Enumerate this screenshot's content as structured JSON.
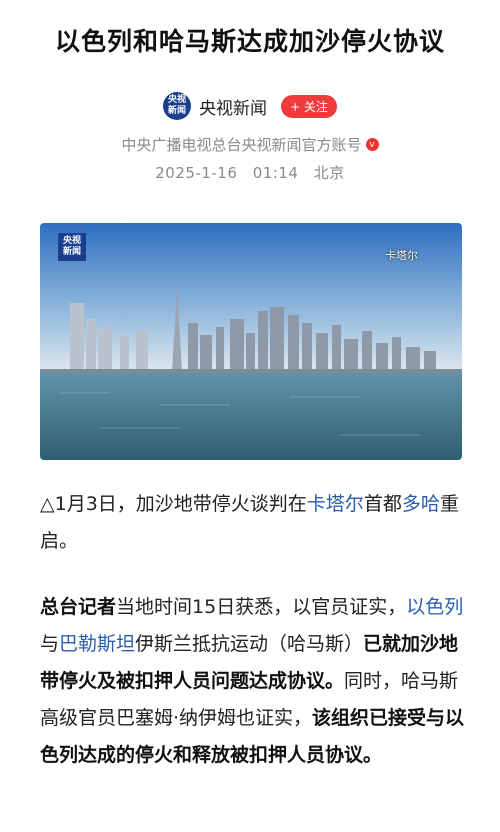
{
  "article": {
    "title": "以色列和哈马斯达成加沙停火协议",
    "source": {
      "logo_line1": "央视",
      "logo_line2": "新闻",
      "name": "央视新闻",
      "follow_label": "+ 关注",
      "account": "中央广播电视总台央视新闻官方账号",
      "verified_icon": "v"
    },
    "date": "2025-1-16",
    "time": "01:14",
    "location": "北京"
  },
  "hero_image": {
    "watermark_line1": "央视",
    "watermark_line2": "新闻",
    "caption_location": "卡塔尔"
  },
  "paragraph1": {
    "p1a": "△1月3日，加沙地带停火谈判在",
    "p1b": "卡塔尔",
    "p1c": "首都",
    "p1d": "多哈",
    "p1e": "重启。"
  },
  "paragraph2": {
    "p2a": "总台记者",
    "p2b": "当地时间15日获悉，以官员证实，",
    "p2c": "以色列",
    "p2d": "与",
    "p2e": "巴勒斯坦",
    "p2f": "伊斯兰抵抗运动（哈马斯）",
    "p2g": "已就加沙地带停火及被扣押人员问题达成协议。",
    "p2h": "同时，哈马斯高级官员巴塞姆·纳伊姆也证实，",
    "p2i": "该组织已接受与以色列达成的停火和释放被扣押人员协议。"
  },
  "colors": {
    "link": "#2a5db0",
    "follow": "#f03b3b",
    "brand": "#1b3f8f",
    "meta": "#8a8a8a"
  }
}
